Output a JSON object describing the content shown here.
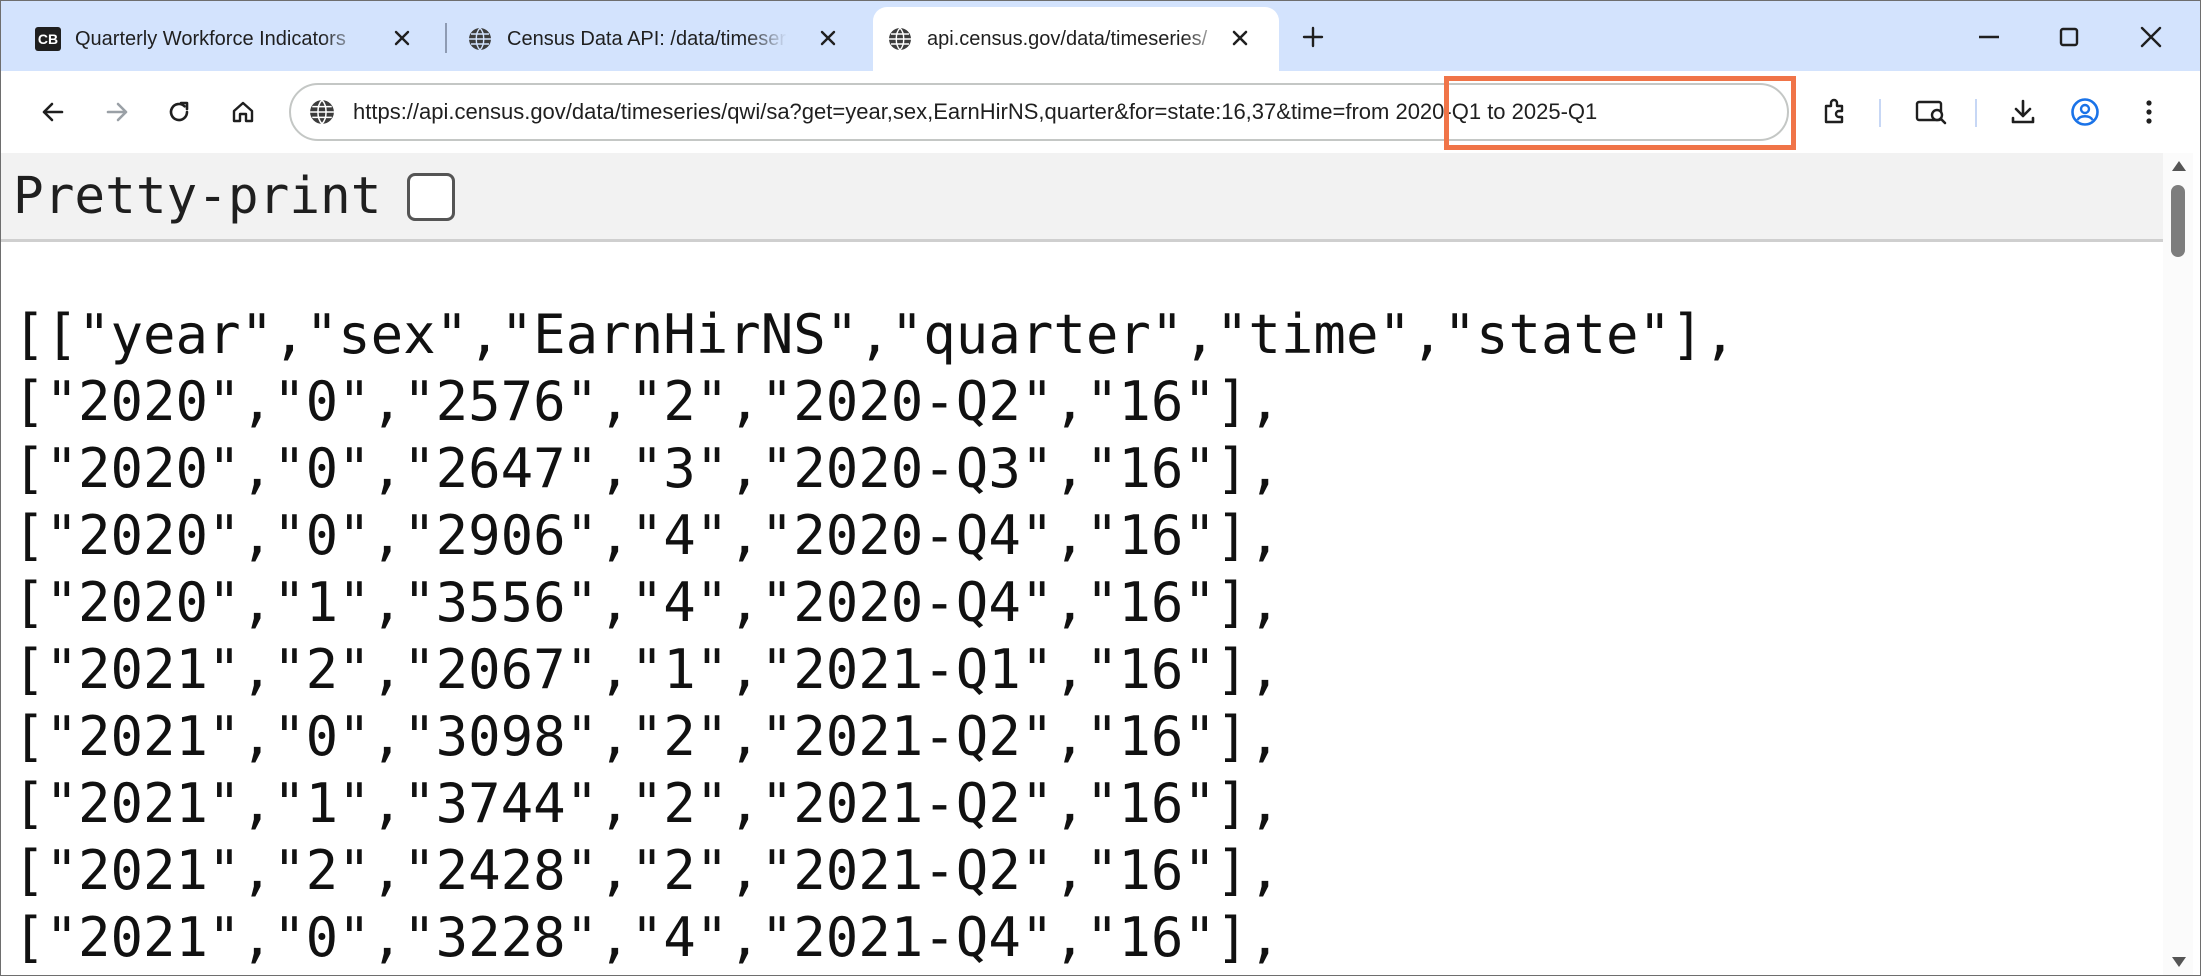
{
  "tabs": [
    {
      "label": "Quarterly Workforce Indicators",
      "icon": "cb-logo-icon",
      "icon_text": "CB",
      "active": false
    },
    {
      "label": "Census Data API: /data/timeseries",
      "icon": "globe-icon",
      "active": false
    },
    {
      "label": "api.census.gov/data/timeseries/",
      "icon": "globe-icon",
      "active": true
    }
  ],
  "toolbar": {
    "url": "https://api.census.gov/data/timeseries/qwi/sa?get=year,sex,EarnHirNS,quarter&for=state:16,37&time=from 2020-Q1 to 2025-Q1"
  },
  "page": {
    "pretty_print_label": "Pretty-print",
    "pretty_print_checked": false,
    "json_lines": [
      "[[\"year\",\"sex\",\"EarnHirNS\",\"quarter\",\"time\",\"state\"],",
      "[\"2020\",\"0\",\"2576\",\"2\",\"2020-Q2\",\"16\"],",
      "[\"2020\",\"0\",\"2647\",\"3\",\"2020-Q3\",\"16\"],",
      "[\"2020\",\"0\",\"2906\",\"4\",\"2020-Q4\",\"16\"],",
      "[\"2020\",\"1\",\"3556\",\"4\",\"2020-Q4\",\"16\"],",
      "[\"2021\",\"2\",\"2067\",\"1\",\"2021-Q1\",\"16\"],",
      "[\"2021\",\"0\",\"3098\",\"2\",\"2021-Q2\",\"16\"],",
      "[\"2021\",\"1\",\"3744\",\"2\",\"2021-Q2\",\"16\"],",
      "[\"2021\",\"2\",\"2428\",\"2\",\"2021-Q2\",\"16\"],",
      "[\"2021\",\"0\",\"3228\",\"4\",\"2021-Q4\",\"16\"],"
    ]
  },
  "colors": {
    "tabstrip": "#d3e3fd",
    "highlight": "#f07448",
    "profile_accent": "#1a73e8"
  }
}
